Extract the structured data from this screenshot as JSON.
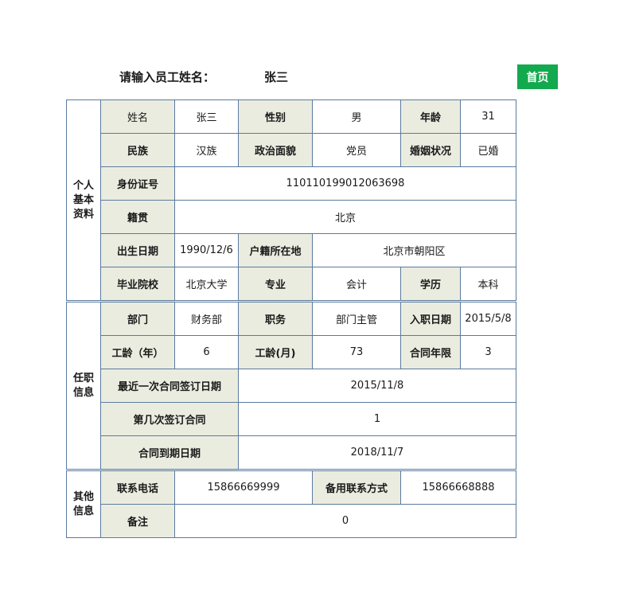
{
  "header": {
    "prompt_label": "请输入员工姓名：",
    "prompt_value": "张三",
    "home_button": "首页"
  },
  "colors": {
    "accent": "#13a94e",
    "label_bg": "#ebece0",
    "border": "#5b7a9e"
  },
  "personal": {
    "section_label": "个人基本资料",
    "name_label": "姓名",
    "name": "张三",
    "gender_label": "性别",
    "gender": "男",
    "age_label": "年龄",
    "age": "31",
    "ethnicity_label": "民族",
    "ethnicity": "汉族",
    "political_label": "政治面貌",
    "political": "党员",
    "marital_label": "婚姻状况",
    "marital": "已婚",
    "id_label": "身份证号",
    "id": "110110199012063698",
    "native_label": "籍贯",
    "native": "北京",
    "birth_label": "出生日期",
    "birth": "1990/12/6",
    "household_label": "户籍所在地",
    "household": "北京市朝阳区",
    "school_label": "毕业院校",
    "school": "北京大学",
    "major_label": "专业",
    "major": "会计",
    "education_label": "学历",
    "education": "本科"
  },
  "employment": {
    "section_label": "任职信息",
    "dept_label": "部门",
    "dept": "财务部",
    "position_label": "职务",
    "position": "部门主管",
    "hire_label": "入职日期",
    "hire": "2015/5/8",
    "years_label": "工龄（年）",
    "years": "6",
    "months_label": "工龄(月)",
    "months": "73",
    "contract_years_label": "合同年限",
    "contract_years": "3",
    "last_sign_label": "最近一次合同签订日期",
    "last_sign": "2015/11/8",
    "sign_count_label": "第几次签订合同",
    "sign_count": "1",
    "expire_label": "合同到期日期",
    "expire": "2018/11/7"
  },
  "other": {
    "section_label": "其他信息",
    "phone_label": "联系电话",
    "phone": "15866669999",
    "alt_label": "备用联系方式",
    "alt": "15866668888",
    "note_label": "备注",
    "note": "0"
  }
}
